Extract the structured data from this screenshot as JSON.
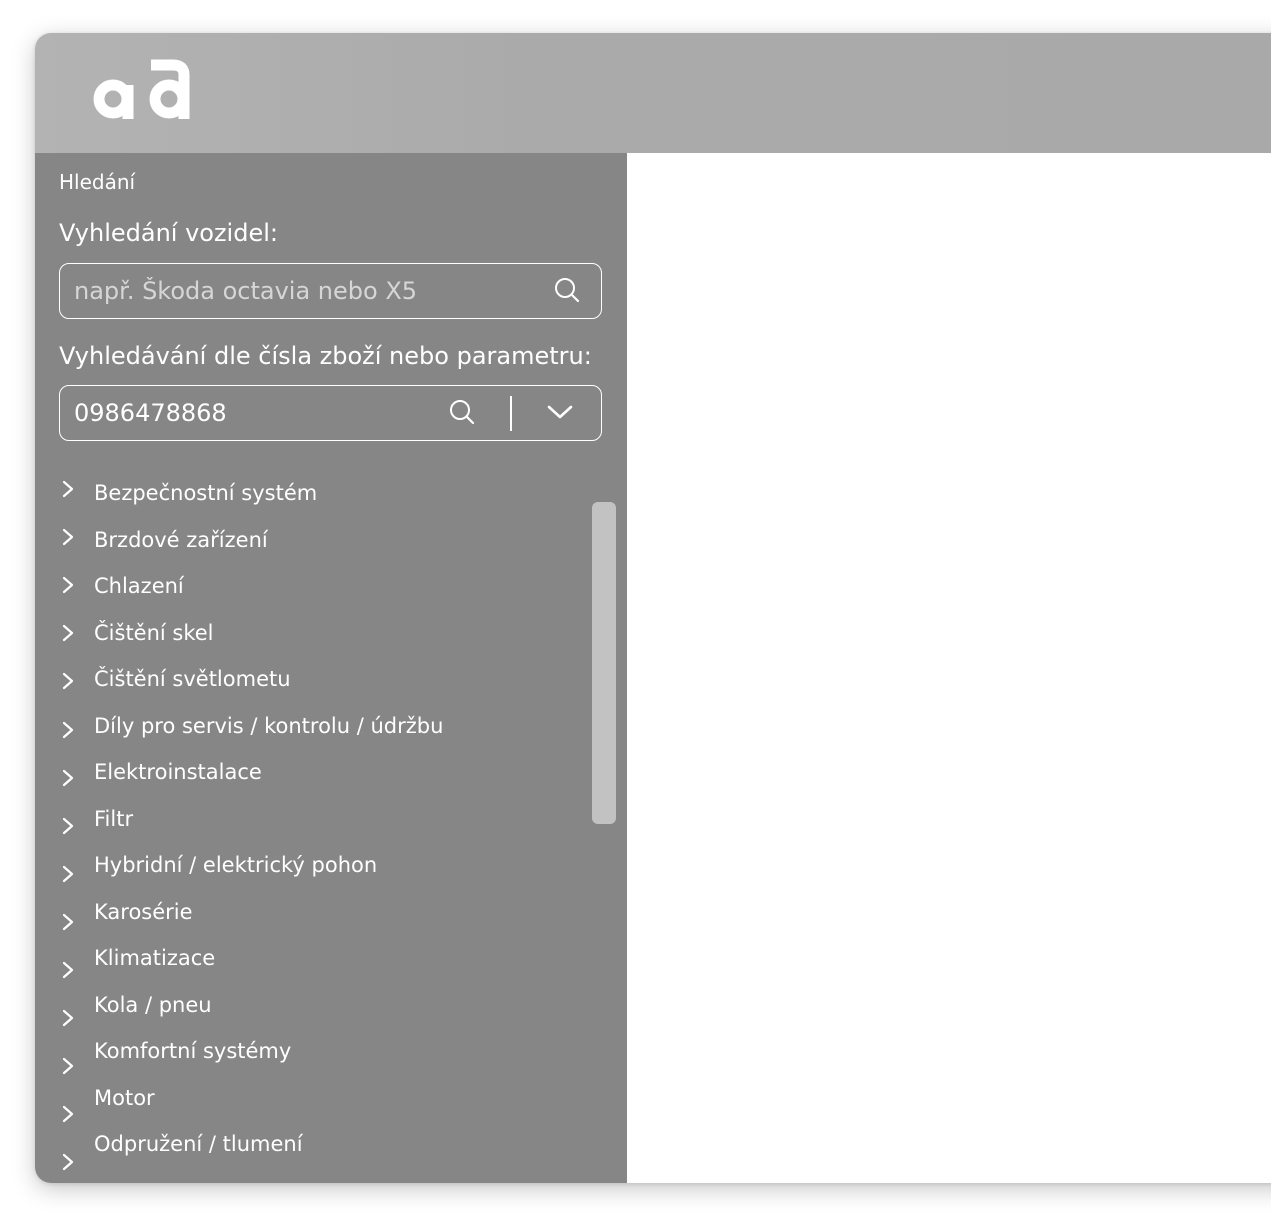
{
  "search": {
    "section_title": "Hledání",
    "vehicle_label": "Vyhledání vozidel:",
    "vehicle_placeholder": "např. Škoda octavia nebo X5",
    "vehicle_value": "",
    "part_label": "Vyhledávání dle čísla zboží nebo parametru:",
    "part_value": "0986478868",
    "search_icon": "search-icon",
    "dropdown_icon": "chevron-down-icon"
  },
  "categories": [
    {
      "label": "Bezpečnostní systém"
    },
    {
      "label": "Brzdové zařízení"
    },
    {
      "label": "Chlazení"
    },
    {
      "label": "Čištění skel"
    },
    {
      "label": "Čištění světlometu"
    },
    {
      "label": "Díly pro servis / kontrolu / údržbu"
    },
    {
      "label": "Elektroinstalace"
    },
    {
      "label": "Filtr"
    },
    {
      "label": "Hybridní / elektrický pohon"
    },
    {
      "label": "Karosérie"
    },
    {
      "label": "Klimatizace"
    },
    {
      "label": "Kola / pneu"
    },
    {
      "label": "Komfortní systémy"
    },
    {
      "label": "Motor"
    },
    {
      "label": "Odpružení / tlumení"
    }
  ],
  "colors": {
    "header": "#aaaaaa",
    "sidebar": "#868686",
    "scrollbar": "#c2c2c2",
    "text": "#ffffff"
  }
}
